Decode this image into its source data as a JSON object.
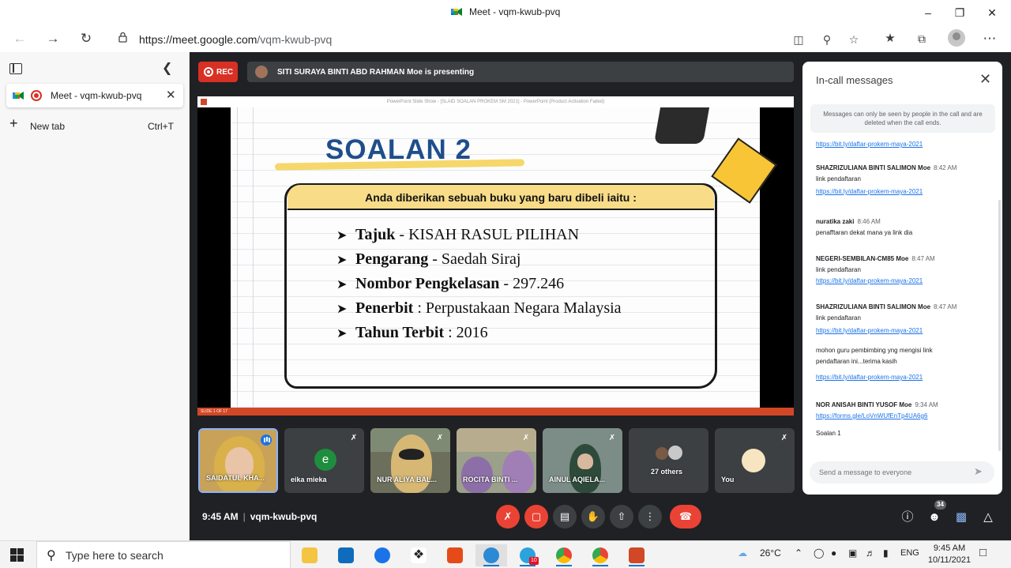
{
  "window": {
    "title": "Meet - vqm-kwub-pvq"
  },
  "address_bar": {
    "url_origin": "https://meet.google.com",
    "url_path": "/vqm-kwub-pvq"
  },
  "tabs_panel": {
    "tabs": [
      {
        "label": "Meet - vqm-kwub-pvq"
      }
    ],
    "new_tab_label": "New tab",
    "new_tab_shortcut": "Ctrl+T"
  },
  "meet": {
    "rec_label": "REC",
    "presenting_text": "SITI SURAYA BINTI ABD RAHMAN Moe is presenting",
    "screen": {
      "pp_window_title": "PowerPoint Slide Show - [SLAID SOALAN PROKEM SM 2021] - PowerPoint (Product Activation Failed)",
      "pp_status": "SLIDE 1 OF 17"
    },
    "slide": {
      "title": "SOALAN 2",
      "box_heading": "Anda diberikan sebuah buku yang baru dibeli iaitu :",
      "items": [
        {
          "label": "Tajuk",
          "sep": " - ",
          "value": "KISAH RASUL PILIHAN"
        },
        {
          "label": "Pengarang",
          "sep": " - ",
          "value": "Saedah Siraj"
        },
        {
          "label": "Nombor Pengkelasan",
          "sep": " - ",
          "value": "297.246"
        },
        {
          "label": "Penerbit",
          "sep": " : ",
          "value": "Perpustakaan Negara Malaysia"
        },
        {
          "label": "Tahun Terbit",
          "sep": " : ",
          "value": "2016"
        }
      ]
    },
    "participants": [
      {
        "name": "SAIDATUL KHA..."
      },
      {
        "name": "eika mieka",
        "initial": "e"
      },
      {
        "name": "NUR ALIYA BAL..."
      },
      {
        "name": "ROCITA BINTI ..."
      },
      {
        "name": "AINUL AQIELA..."
      },
      {
        "name": "27 others"
      },
      {
        "name": "You"
      }
    ],
    "time": "9:45 AM",
    "meeting_code": "vqm-kwub-pvq",
    "participant_count": "34",
    "chat": {
      "title": "In-call messages",
      "notice": "Messages can only be seen by people in the call and are deleted when the call ends.",
      "placeholder": "Send a message to everyone",
      "messages": [
        {
          "sender": "",
          "time": "",
          "lines": [],
          "link": "https://bit.ly/daftar-prokem-maya-2021"
        },
        {
          "sender": "SHAZRIZULIANA BINTI SALIMON Moe",
          "time": "8:42 AM",
          "lines": [
            "link pendaftaran"
          ],
          "link": "https://bit.ly/daftar-prokem-maya-2021"
        },
        {
          "sender": "nuratika zaki",
          "time": "8:46 AM",
          "lines": [
            "penafftaran dekat mana ya link dia"
          ],
          "link": ""
        },
        {
          "sender": "NEGERI-SEMBILAN-CM85 Moe",
          "time": "8:47 AM",
          "lines": [
            "link pendaftaran"
          ],
          "link": "https://bit.ly/daftar-prokem-maya-2021"
        },
        {
          "sender": "SHAZRIZULIANA BINTI SALIMON Moe",
          "time": "8:47 AM",
          "lines": [
            "link pendaftaran"
          ],
          "link": "https://bit.ly/daftar-prokem-maya-2021"
        },
        {
          "sender": "",
          "time": "",
          "lines": [
            "mohon guru pembimbing yng mengisi link pendaftaran ini...terima kasih"
          ],
          "link": "https://bit.ly/daftar-prokem-maya-2021"
        },
        {
          "sender": "NOR ANISAH BINTI YUSOF Moe",
          "time": "9:34 AM",
          "lines": [],
          "link": "https://forms.gle/LoVnWUfEnTp4UA6g6"
        },
        {
          "sender": "",
          "time": "",
          "lines": [
            "Soalan 1"
          ],
          "link": ""
        }
      ]
    }
  },
  "taskbar": {
    "search_placeholder": "Type here to search",
    "temperature": "26°C",
    "language": "ENG",
    "clock_time": "9:45 AM",
    "clock_date": "10/11/2021",
    "mail_badge": "10"
  },
  "colors": {
    "meet_bg": "#202124",
    "rec_red": "#d93025",
    "link_blue": "#1a73e8",
    "slide_title": "#1f4e8c",
    "slide_yellow": "#f8dc88"
  }
}
